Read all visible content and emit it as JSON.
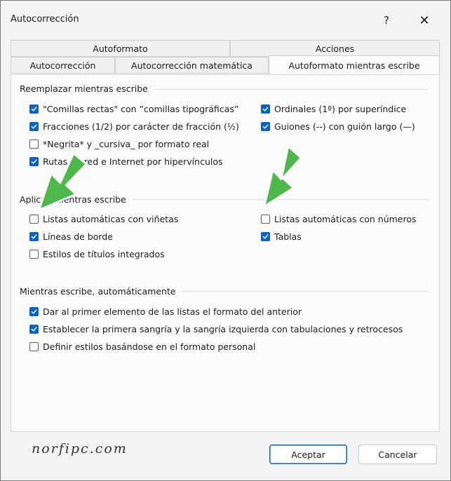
{
  "window": {
    "title": "Autocorrección",
    "help_label": "?",
    "close_label": "✕"
  },
  "tabs_row1": [
    {
      "label": "Autoformato"
    },
    {
      "label": "Acciones"
    }
  ],
  "tabs_row2": [
    {
      "label": "Autocorrección"
    },
    {
      "label": "Autocorrección matemática"
    },
    {
      "label": "Autoformato mientras escribe",
      "active": true
    }
  ],
  "groups": {
    "replace": {
      "title": "Reemplazar mientras escribe",
      "left": [
        {
          "label": "\"Comillas rectas\" con ”comillas tipográficas”",
          "checked": true
        },
        {
          "label": "Fracciones (1/2) por carácter de fracción (½)",
          "checked": true
        },
        {
          "label": "*Negrita* y _cursiva_ por formato real",
          "checked": false
        },
        {
          "label": "Rutas de red e Internet por hipervínculos",
          "checked": true
        }
      ],
      "right": [
        {
          "label": "Ordinales (1º) por superíndice",
          "checked": true
        },
        {
          "label": "Guiones (--) con guión largo (—)",
          "checked": true
        }
      ]
    },
    "apply": {
      "title": "Aplicar mientras escribe",
      "left": [
        {
          "label": "Listas automáticas con viñetas",
          "checked": false
        },
        {
          "label": "Líneas de borde",
          "checked": true
        },
        {
          "label": "Estilos de títulos integrados",
          "checked": false
        }
      ],
      "right": [
        {
          "label": "Listas automáticas con números",
          "checked": false
        },
        {
          "label": "Tablas",
          "checked": true
        }
      ]
    },
    "auto": {
      "title": "Mientras escribe, automáticamente",
      "items": [
        {
          "label": "Dar al primer elemento de las listas el formato del anterior",
          "checked": true
        },
        {
          "label": "Establecer la primera sangría y la sangría izquierda con tabulaciones y retrocesos",
          "checked": true
        },
        {
          "label": "Definir estilos basándose en el formato personal",
          "checked": false
        }
      ]
    }
  },
  "watermark": "norfipc.com",
  "buttons": {
    "accept": "Aceptar",
    "cancel": "Cancelar"
  },
  "colors": {
    "check_fill": "#0a61c6",
    "arrow_fill": "#4db84a"
  }
}
